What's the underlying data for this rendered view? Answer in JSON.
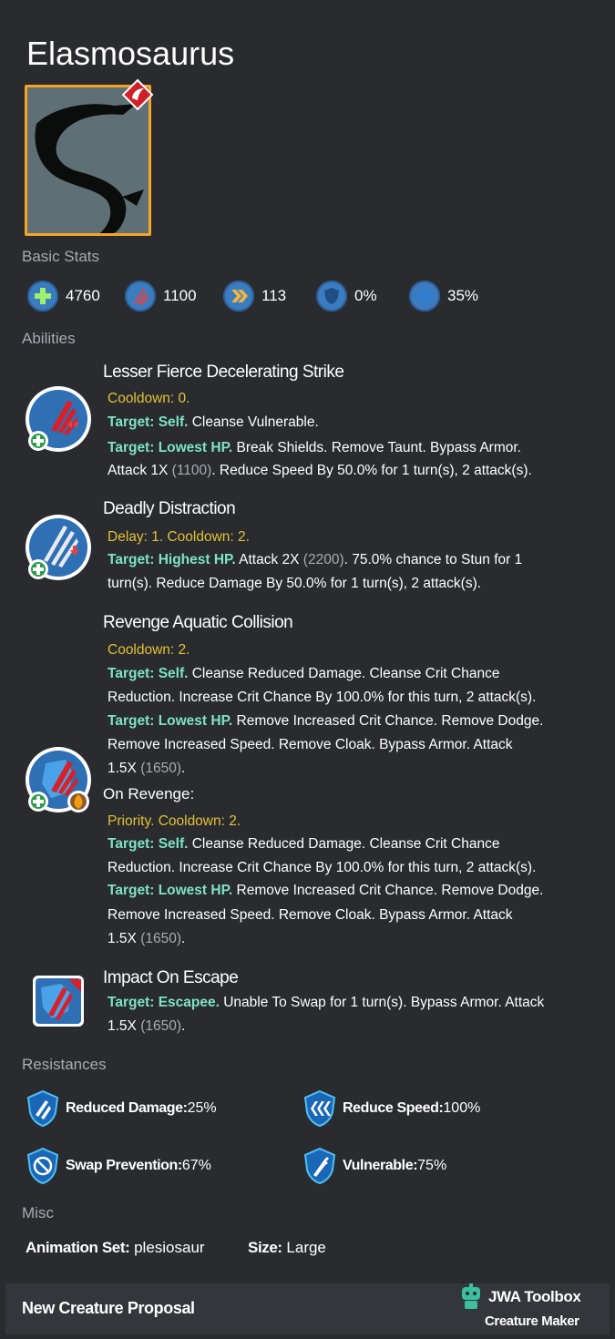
{
  "creature": {
    "name": "Elasmosaurus"
  },
  "colors": {
    "accent": "#7ee3c5",
    "warning": "#e2c132",
    "frame": "#f5a623",
    "icon_blue": "#3b7cc0"
  },
  "sections": {
    "basic_stats": "Basic Stats",
    "abilities": "Abilities",
    "resistances": "Resistances",
    "misc": "Misc"
  },
  "stats": [
    {
      "icon": "health-icon",
      "value": "4760"
    },
    {
      "icon": "damage-icon",
      "value": "1100"
    },
    {
      "icon": "speed-icon",
      "value": "113"
    },
    {
      "icon": "armor-icon",
      "value": "0%"
    },
    {
      "icon": "crit-icon",
      "value": "35%"
    }
  ],
  "abilities": {
    "a1": {
      "name": "Lesser Fierce Decelerating Strike",
      "timing": "Cooldown: 0.",
      "l1_target": "Target: Self.",
      "l1_text": " Cleanse Vulnerable.",
      "l2_target": "Target: Lowest HP.",
      "l2_text": " Break Shields. Remove Taunt. Bypass Armor.",
      "l3_a": "Attack 1X ",
      "l3_val": "(1100)",
      "l3_b": ". Reduce Speed By 50.0% for 1 turn(s), 2 attack(s)."
    },
    "a2": {
      "name": "Deadly Distraction",
      "timing": "Delay: 1. Cooldown: 2.",
      "l1_target": "Target: Highest HP.",
      "l1_a": " Attack 2X ",
      "l1_val": "(2200)",
      "l1_b": ". 75.0% chance to Stun for 1",
      "l2_text": "turn(s). Reduce Damage By 50.0% for 1 turn(s), 2 attack(s)."
    },
    "a3": {
      "name": "Revenge Aquatic Collision",
      "timing": "Cooldown: 2.",
      "l1_target": "Target: Self.",
      "l1_text": " Cleanse Reduced Damage. Cleanse Crit Chance",
      "l2_text": "Reduction. Increase Crit Chance By 100.0% for this turn, 2 attack(s).",
      "l3_target": "Target: Lowest HP.",
      "l3_text": " Remove Increased Crit Chance. Remove Dodge.",
      "l4_text": "Remove Increased Speed. Remove Cloak. Bypass Armor. Attack",
      "l5_a": "1.5X ",
      "l5_val": "(1650)",
      "l5_b": ".",
      "revenge_label": "On Revenge:",
      "r_timing": "Priority. Cooldown: 2.",
      "r1_target": "Target: Self.",
      "r1_text": " Cleanse Reduced Damage. Cleanse Crit Chance",
      "r2_text": "Reduction. Increase Crit Chance By 100.0% for this turn, 2 attack(s).",
      "r3_target": "Target: Lowest HP.",
      "r3_text": " Remove Increased Crit Chance. Remove Dodge.",
      "r4_text": "Remove Increased Speed. Remove Cloak. Bypass Armor. Attack",
      "r5_a": "1.5X ",
      "r5_val": "(1650)",
      "r5_b": "."
    },
    "a4": {
      "name": "Impact On Escape",
      "l1_target": "Target: Escapee.",
      "l1_text": " Unable To Swap for 1 turn(s). Bypass Armor. Attack",
      "l2_a": "1.5X ",
      "l2_val": "(1650)",
      "l2_b": "."
    }
  },
  "resistances": [
    {
      "label": "Reduced Damage:",
      "value": " 25%"
    },
    {
      "label": "Reduce Speed:",
      "value": " 100%"
    },
    {
      "label": "Swap Prevention:",
      "value": " 67%"
    },
    {
      "label": "Vulnerable:",
      "value": " 75%"
    }
  ],
  "misc": {
    "anim_label": "Animation Set:",
    "anim_value": " plesiosaur",
    "size_label": "Size:",
    "size_value": " Large"
  },
  "footer": {
    "left": "New Creature Proposal",
    "brand": "JWA Toolbox",
    "brand_sub": "Creature Maker"
  }
}
